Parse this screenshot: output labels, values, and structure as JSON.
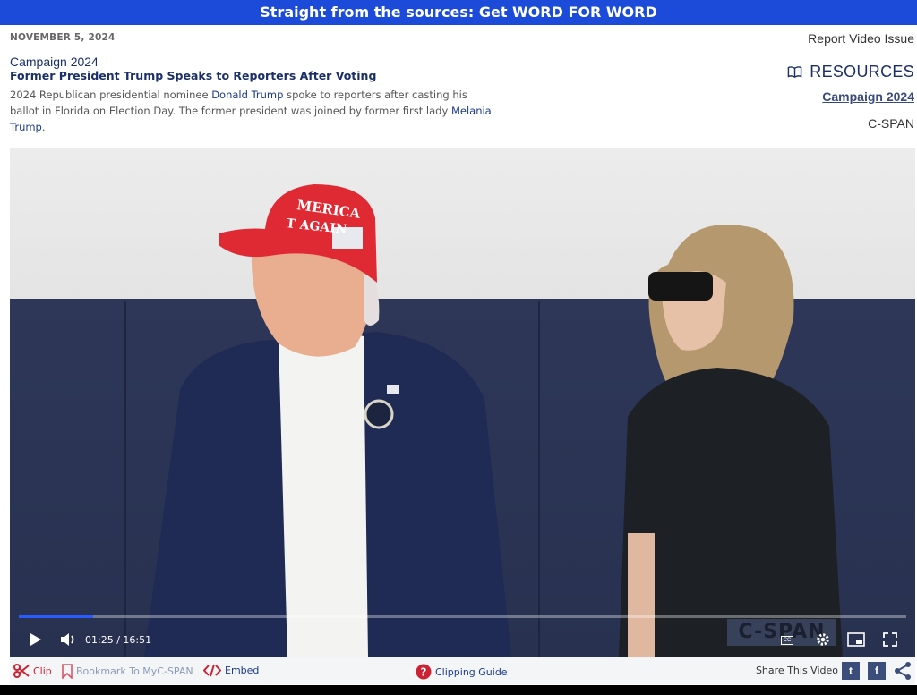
{
  "banner": {
    "text": "Straight from the sources: Get WORD FOR WORD"
  },
  "header": {
    "date": "NOVEMBER 5, 2024",
    "report": "Report Video Issue",
    "category": "Campaign 2024",
    "title": "Former President Trump Speaks to Reporters After Voting",
    "desc_1": "2024 Republican presidential nominee ",
    "desc_link_1": "Donald Trump",
    "desc_2": " spoke to reporters after casting his ballot in Florida on Election Day. The former president was joined by former first lady ",
    "desc_link_2": "Melania Trump",
    "desc_3": "."
  },
  "resources": {
    "heading": "RESOURCES",
    "icon": "book-icon",
    "link": "Campaign 2024",
    "source": "C-SPAN"
  },
  "player": {
    "current_time": "01:25",
    "separator": "/",
    "duration": "16:51",
    "progress_fraction": 0.084,
    "logo_text": "C-SPAN",
    "cc_label": "CC"
  },
  "toolbar": {
    "clip": "Clip",
    "bookmark": "Bookmark To MyC-SPAN",
    "embed": "Embed",
    "guide": "Clipping Guide",
    "share": "Share This Video",
    "twitter": "t",
    "facebook": "f"
  },
  "colors": {
    "banner": "#1b4bd8",
    "link": "#1b3a8c",
    "clip": "#cc2233",
    "progress": "#2a5bff"
  }
}
